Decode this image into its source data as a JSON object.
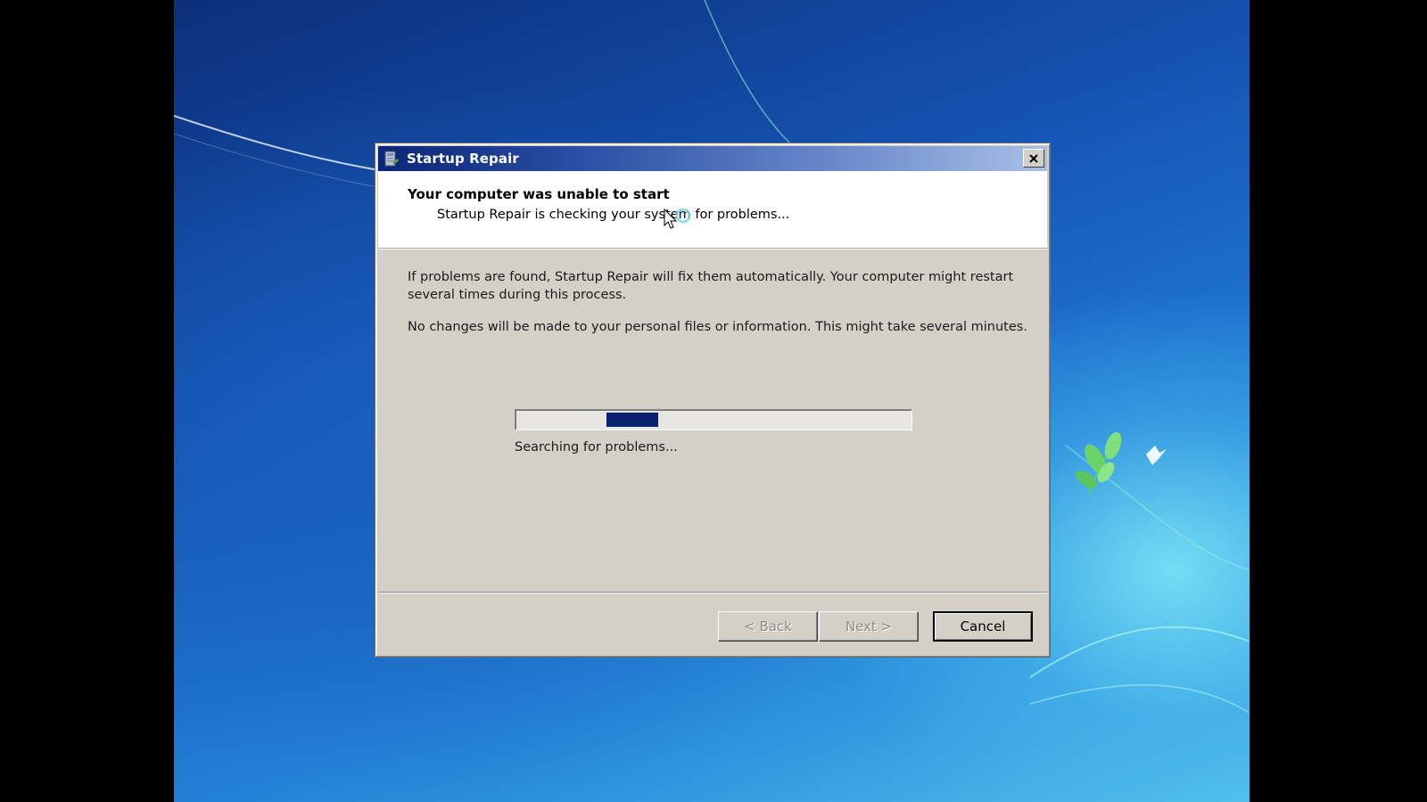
{
  "window": {
    "title": "Startup Repair",
    "icon": "startup-repair-icon",
    "close_icon": "close-icon"
  },
  "header": {
    "title": "Your computer was unable to start",
    "subtitle": "Startup Repair is checking your system for problems..."
  },
  "body": {
    "paragraph1": "If problems are found, Startup Repair will fix them automatically. Your computer might restart several times during this process.",
    "paragraph2": "No changes will be made to your personal files or information. This might take several minutes."
  },
  "progress": {
    "mode": "indeterminate",
    "chunk_start": 0.23,
    "chunk_end": 0.36,
    "color": "#0a216f",
    "status": "Searching for problems..."
  },
  "buttons": {
    "back": "< Back",
    "next": "Next >",
    "cancel": "Cancel"
  },
  "colors": {
    "titlebar_start": "#0b2577",
    "titlebar_end": "#a9c0e6",
    "dialog_bg": "#d4d0c8"
  }
}
